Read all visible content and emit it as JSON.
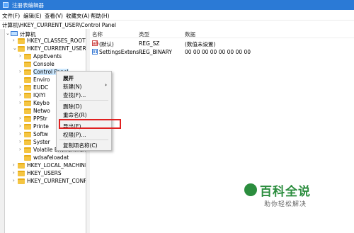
{
  "window": {
    "title": "注册表编辑器"
  },
  "menu": [
    "文件(F)",
    "编辑(E)",
    "查看(V)",
    "收藏夹(A)",
    "帮助(H)"
  ],
  "address": "计算机\\HKEY_CURRENT_USER\\Control Panel",
  "tree": {
    "root": "计算机",
    "items": [
      {
        "label": "HKEY_CLASSES_ROOT"
      },
      {
        "label": "HKEY_CURRENT_USER"
      },
      {
        "label": "AppEvents"
      },
      {
        "label": "Console"
      },
      {
        "label": "Control Panel"
      },
      {
        "label": "Enviro"
      },
      {
        "label": "EUDC"
      },
      {
        "label": "IQIYI"
      },
      {
        "label": "Keybo"
      },
      {
        "label": "Netwo"
      },
      {
        "label": "PPStr"
      },
      {
        "label": "Printe"
      },
      {
        "label": "Softw"
      },
      {
        "label": "Syster"
      },
      {
        "label": "Volatile Environment"
      },
      {
        "label": "wdsafeloadat"
      },
      {
        "label": "HKEY_LOCAL_MACHINE"
      },
      {
        "label": "HKEY_USERS"
      },
      {
        "label": "HKEY_CURRENT_CONFIG"
      }
    ]
  },
  "values": {
    "headers": {
      "name": "名称",
      "type": "类型",
      "data": "数据"
    },
    "rows": [
      {
        "name": "(默认)",
        "type": "REG_SZ",
        "data": "(数值未设置)",
        "icon": "string-value-icon"
      },
      {
        "name": "SettingsExtensi...",
        "type": "REG_BINARY",
        "data": "00 00 00 00 00 00 00 00",
        "icon": "binary-value-icon"
      }
    ]
  },
  "context_menu": {
    "items": [
      {
        "label": "展开"
      },
      {
        "label": "新建(N)",
        "arrow": "›"
      },
      {
        "label": "查找(F)..."
      },
      {
        "label": "删除(D)"
      },
      {
        "label": "重命名(R)"
      },
      {
        "label": "导出(E)"
      },
      {
        "label": "权限(P)..."
      },
      {
        "label": "复制项名称(C)"
      }
    ],
    "highlighted": "导出(E)"
  },
  "watermark": {
    "brand": "百科全说",
    "tagline": "助你轻松解决"
  }
}
